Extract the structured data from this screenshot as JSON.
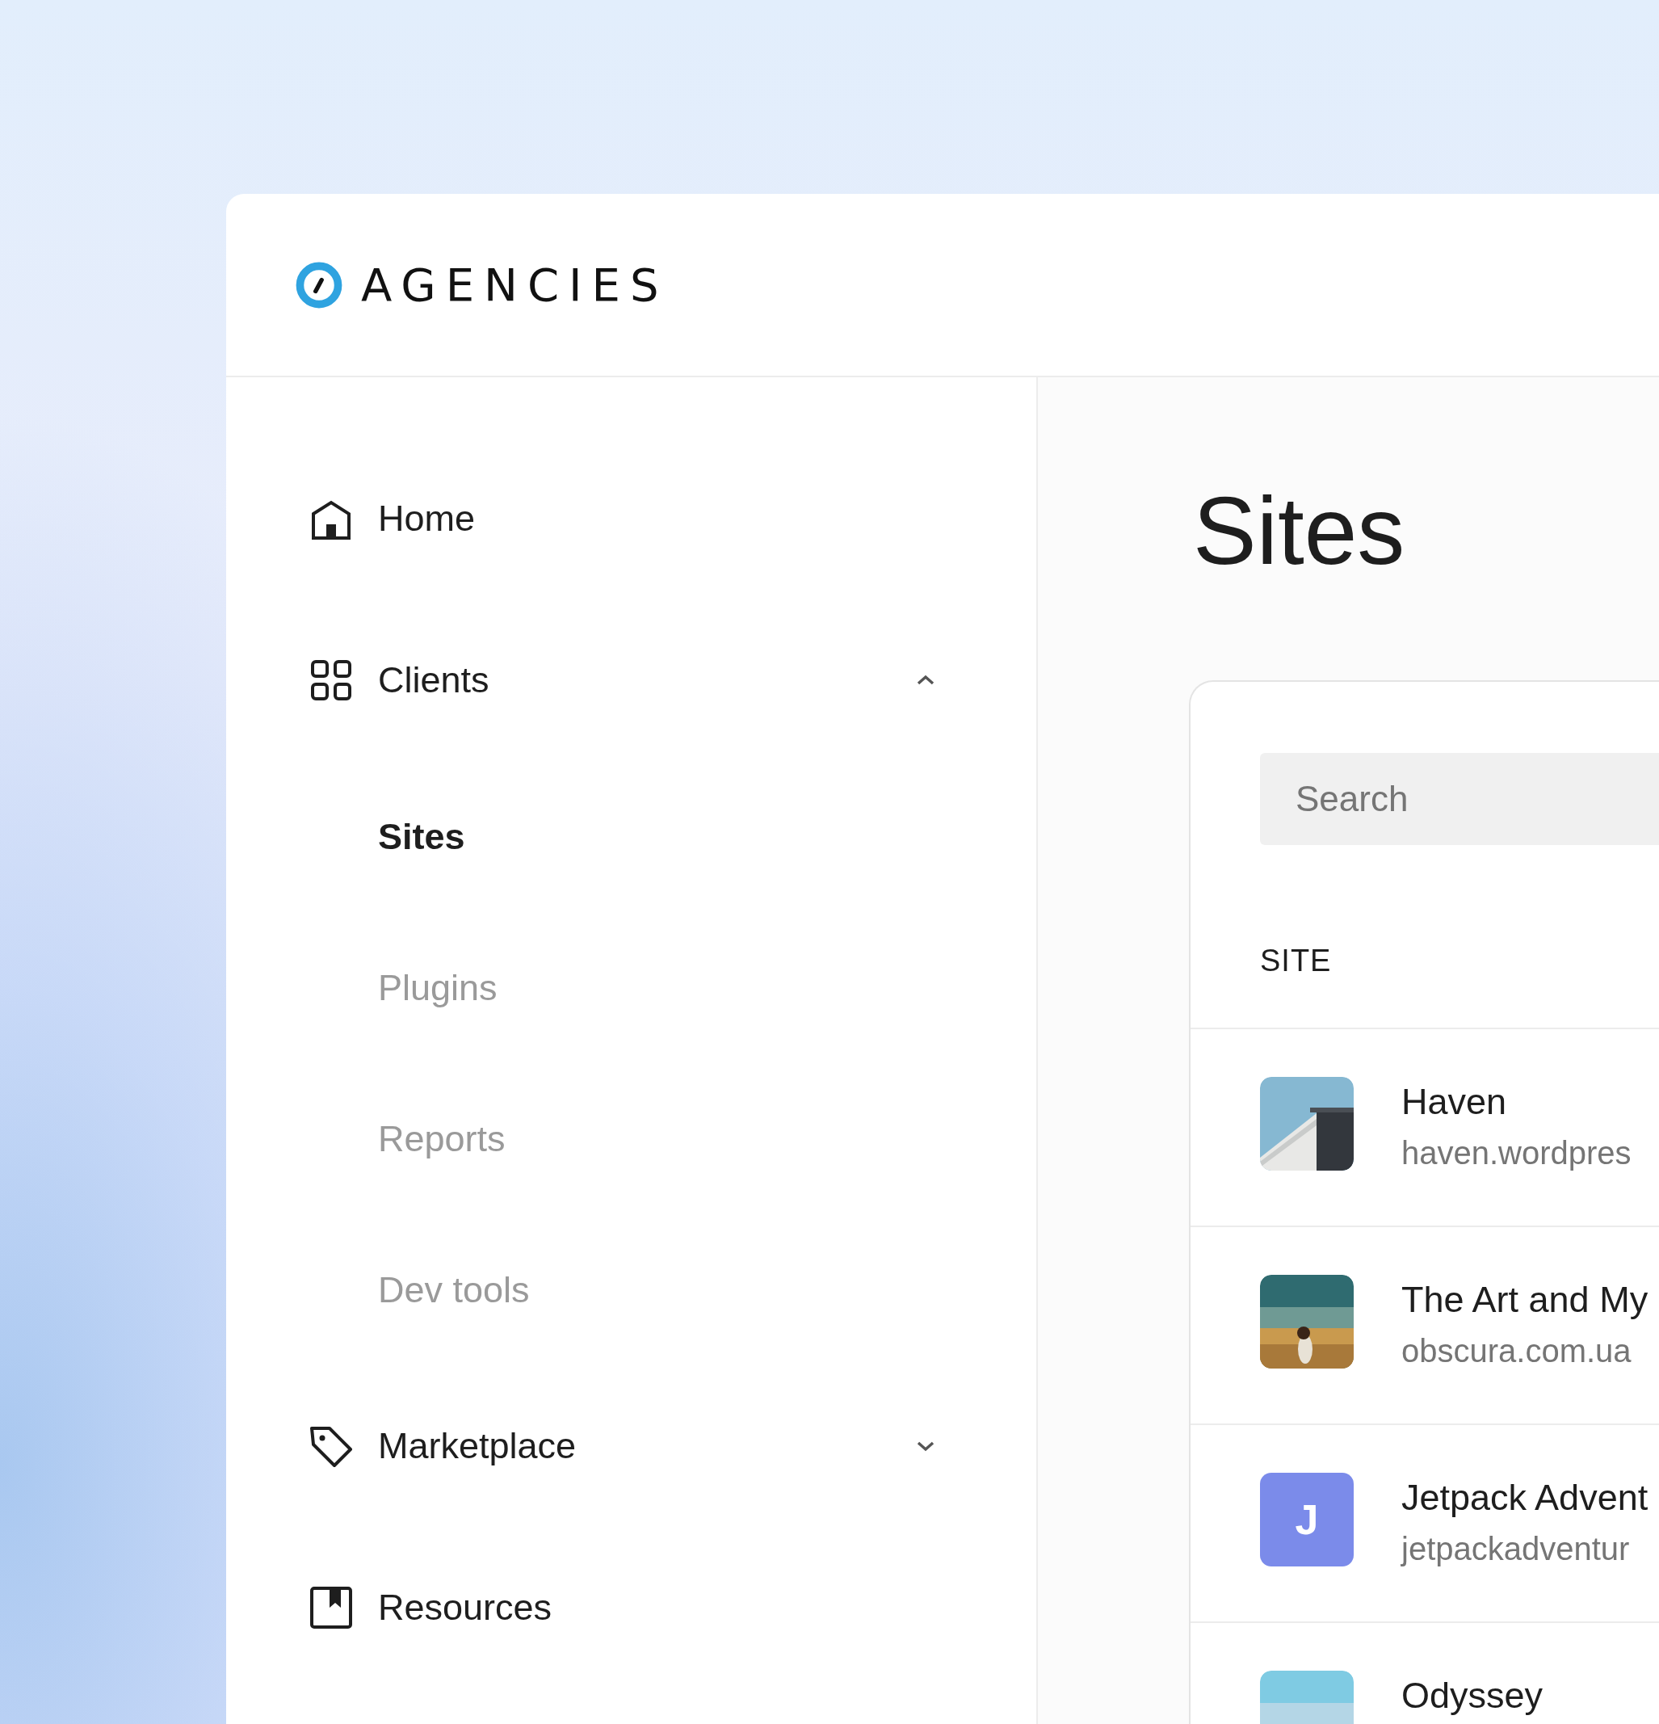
{
  "logo": {
    "text": "AGENCIES"
  },
  "nav": [
    {
      "label": "Home",
      "kind": "link"
    },
    {
      "label": "Clients",
      "kind": "group",
      "expanded": true,
      "children": [
        {
          "label": "Sites",
          "selected": true
        },
        {
          "label": "Plugins",
          "selected": false
        },
        {
          "label": "Reports",
          "selected": false
        },
        {
          "label": "Dev tools",
          "selected": false
        }
      ]
    },
    {
      "label": "Marketplace",
      "kind": "group",
      "expanded": false
    },
    {
      "label": "Resources",
      "kind": "link"
    }
  ],
  "page_title": "Sites",
  "search": {
    "placeholder": "Search"
  },
  "table": {
    "columns": [
      "SITE"
    ],
    "rows": [
      {
        "name": "Haven",
        "url": "haven.wordpres"
      },
      {
        "name": "The Art and My",
        "url": "obscura.com.ua"
      },
      {
        "name": "Jetpack Advent",
        "url": "jetpackadventur",
        "thumb": {
          "kind": "initial",
          "letter": "J",
          "color": "#7b8bea"
        }
      },
      {
        "name": "Odyssey"
      }
    ]
  }
}
